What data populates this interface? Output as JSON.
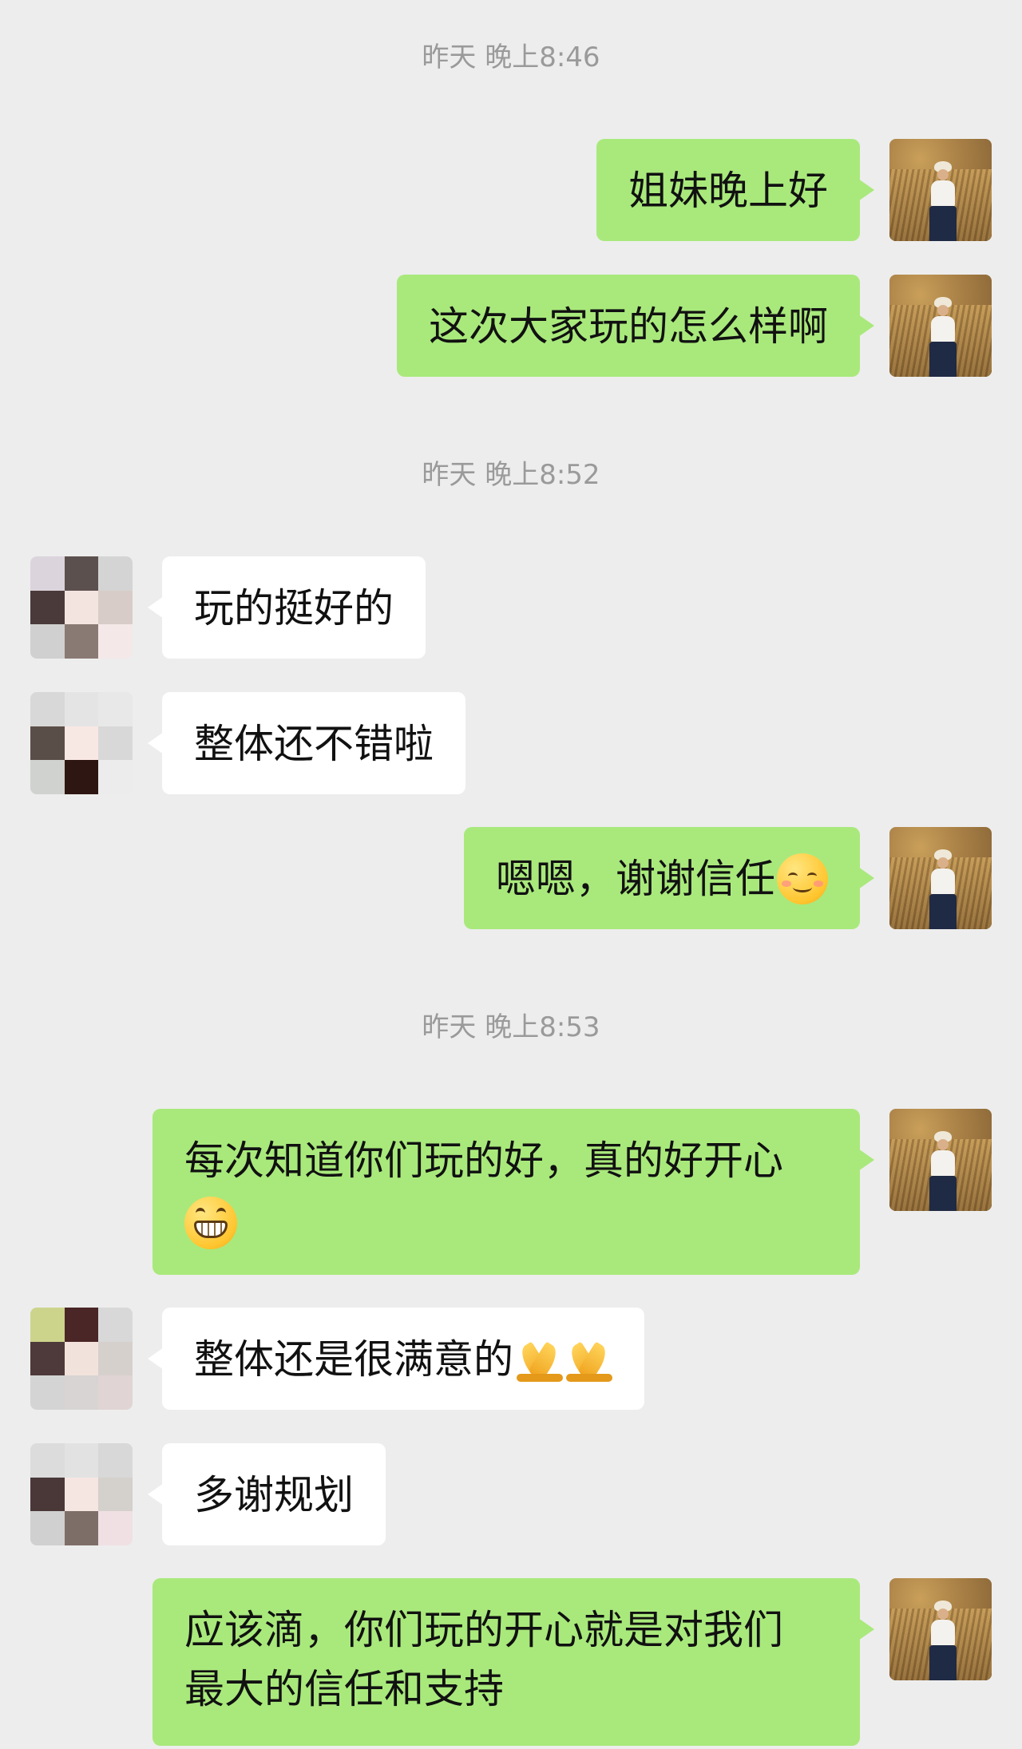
{
  "timestamps": [
    "昨天 晚上8:46",
    "昨天 晚上8:52",
    "昨天 晚上8:53"
  ],
  "messages": [
    {
      "sender": "self",
      "text": "姐妹晚上好"
    },
    {
      "sender": "self",
      "text": "这次大家玩的怎么样啊"
    },
    {
      "sender": "other",
      "text": "玩的挺好的"
    },
    {
      "sender": "other",
      "text": "整体还不错啦"
    },
    {
      "sender": "self",
      "text": "嗯嗯，谢谢信任",
      "emoji": "smiling-face-icon"
    },
    {
      "sender": "self",
      "text": "每次知道你们玩的好，真的好开心",
      "emoji": "grinning-face-icon"
    },
    {
      "sender": "other",
      "text": "整体还是很满意的",
      "emoji": "praying-hands-icon"
    },
    {
      "sender": "other",
      "text": "多谢规划"
    },
    {
      "sender": "self",
      "text_line1": "应该滴，你们玩的开心就是对我们",
      "text_line2": "最大的信任和支持"
    }
  ],
  "colors": {
    "background": "#ededed",
    "self_bubble": "#a9e97c",
    "other_bubble": "#ffffff",
    "timestamp_text": "#9a9a9a"
  }
}
